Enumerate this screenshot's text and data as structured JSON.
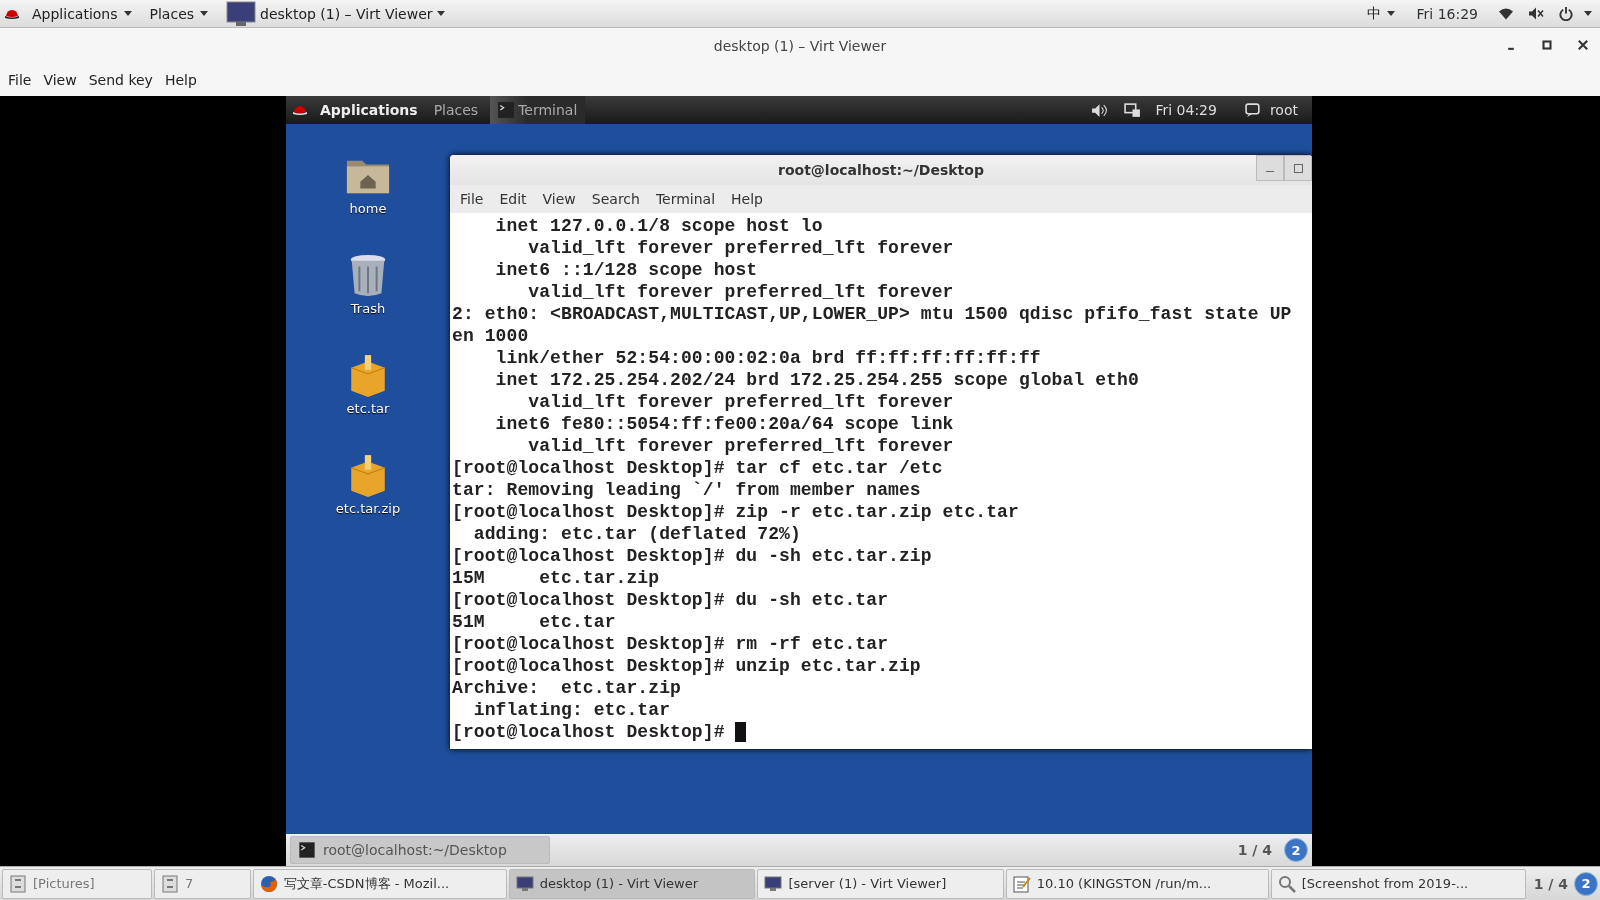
{
  "host_top_bar": {
    "menus": [
      {
        "label": "Applications"
      },
      {
        "label": "Places"
      }
    ],
    "active_window": "desktop (1) – Virt Viewer",
    "input_method": "中",
    "clock": "Fri 16:29"
  },
  "window": {
    "title": "desktop (1) – Virt Viewer",
    "menu": [
      "File",
      "View",
      "Send key",
      "Help"
    ]
  },
  "guest_top_bar": {
    "applications": "Applications",
    "places": "Places",
    "task": "Terminal",
    "clock": "Fri 04:29",
    "user": "root"
  },
  "desktop_icons": [
    {
      "label": "home",
      "kind": "home"
    },
    {
      "label": "Trash",
      "kind": "trash"
    },
    {
      "label": "etc.tar",
      "kind": "package"
    },
    {
      "label": "etc.tar.zip",
      "kind": "package"
    }
  ],
  "terminal": {
    "title": "root@localhost:~/Desktop",
    "menu": [
      "File",
      "Edit",
      "View",
      "Search",
      "Terminal",
      "Help"
    ],
    "cursor": true,
    "lines": [
      "    inet 127.0.0.1/8 scope host lo",
      "       valid_lft forever preferred_lft forever",
      "    inet6 ::1/128 scope host",
      "       valid_lft forever preferred_lft forever",
      "2: eth0: <BROADCAST,MULTICAST,UP,LOWER_UP> mtu 1500 qdisc pfifo_fast state UP",
      "en 1000",
      "    link/ether 52:54:00:00:02:0a brd ff:ff:ff:ff:ff:ff",
      "    inet 172.25.254.202/24 brd 172.25.254.255 scope global eth0",
      "       valid_lft forever preferred_lft forever",
      "    inet6 fe80::5054:ff:fe00:20a/64 scope link",
      "       valid_lft forever preferred_lft forever",
      "[root@localhost Desktop]# tar cf etc.tar /etc",
      "tar: Removing leading `/' from member names",
      "[root@localhost Desktop]# zip -r etc.tar.zip etc.tar",
      "  adding: etc.tar (deflated 72%)",
      "[root@localhost Desktop]# du -sh etc.tar.zip",
      "15M\tetc.tar.zip",
      "[root@localhost Desktop]# du -sh etc.tar",
      "51M\tetc.tar",
      "[root@localhost Desktop]# rm -rf etc.tar",
      "[root@localhost Desktop]# unzip etc.tar.zip",
      "Archive:  etc.tar.zip",
      "  inflating: etc.tar",
      "[root@localhost Desktop]# "
    ]
  },
  "guest_taskbar": {
    "tasks": [
      {
        "label": "root@localhost:~/Desktop",
        "selected": true
      }
    ],
    "pager": "1 / 4",
    "workspace": "2"
  },
  "host_taskbar": {
    "tasks": [
      {
        "label": "[Pictures]",
        "kind": "folder",
        "selected": false
      },
      {
        "label": "7",
        "kind": "folder",
        "selected": false
      },
      {
        "label": "写文章-CSDN博客 - Mozil...",
        "kind": "browser",
        "selected": false
      },
      {
        "label": "desktop (1) - Virt Viewer",
        "kind": "monitor",
        "selected": true
      },
      {
        "label": "[server (1) - Virt Viewer]",
        "kind": "monitor",
        "selected": false
      },
      {
        "label": "10.10 (KINGSTON /run/m...",
        "kind": "editor",
        "selected": false
      },
      {
        "label": "[Screenshot from 2019-...",
        "kind": "viewer",
        "selected": false
      }
    ],
    "pager": "1 / 4",
    "workspace": "2"
  }
}
